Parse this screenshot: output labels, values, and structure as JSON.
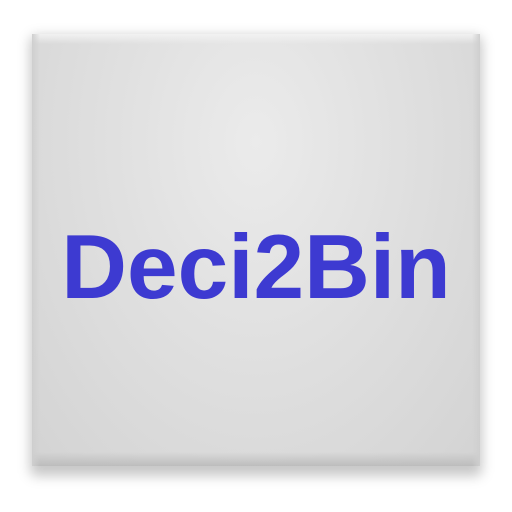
{
  "app": {
    "name": "Deci2Bin"
  },
  "colors": {
    "text": "#3d3ad1",
    "background": "#e0e0e0"
  }
}
